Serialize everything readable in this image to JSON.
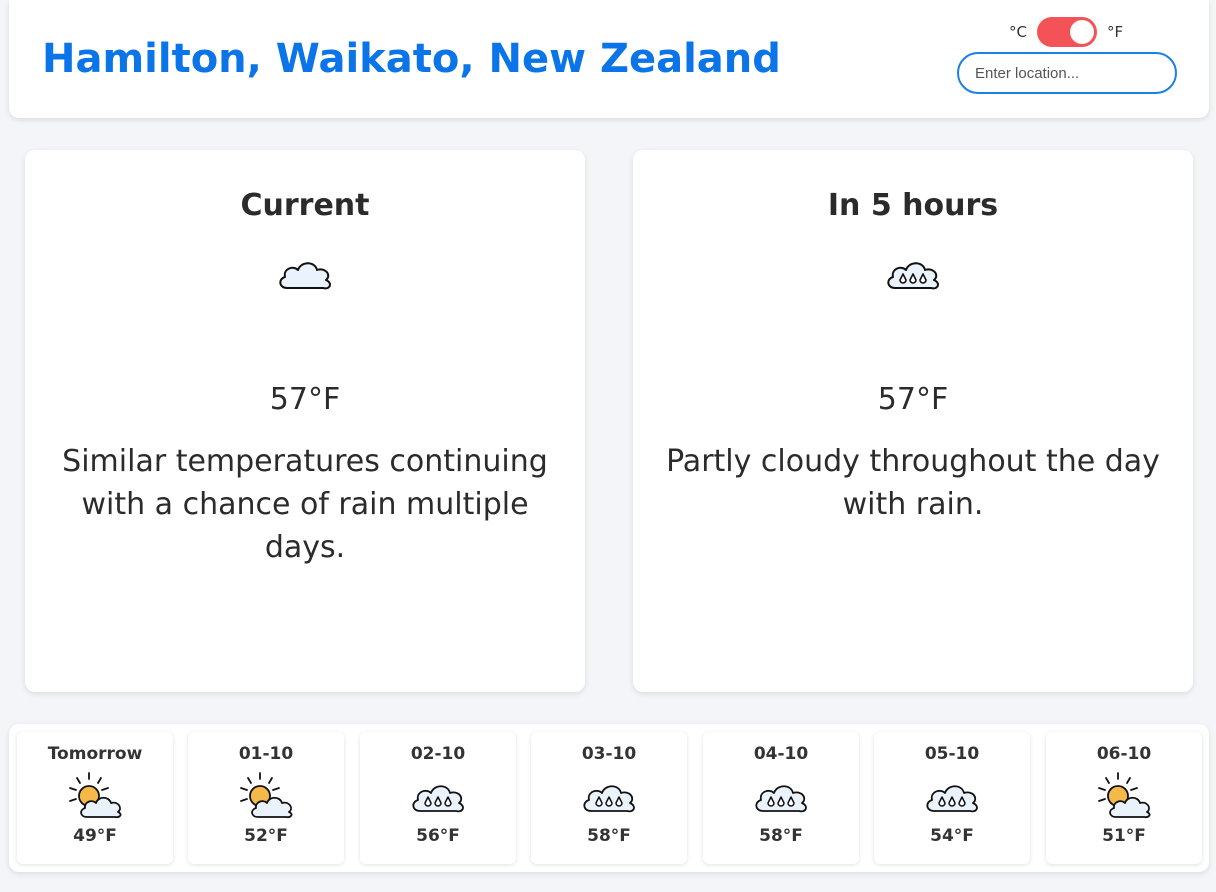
{
  "header": {
    "location": "Hamilton, Waikato, New Zealand",
    "unit_celsius": "°C",
    "unit_fahrenheit": "°F",
    "search_placeholder": "Enter location..."
  },
  "current": {
    "title": "Current",
    "icon": "cloud-icon",
    "temp": "57°F",
    "description": "Similar temperatures continuing with a chance of rain multiple days."
  },
  "later": {
    "title": "In 5 hours",
    "icon": "rain-cloud-icon",
    "temp": "57°F",
    "description": "Partly cloudy throughout the day with rain."
  },
  "forecast": [
    {
      "label": "Tomorrow",
      "icon": "partly-cloudy-icon",
      "temp": "49°F"
    },
    {
      "label": "01-10",
      "icon": "partly-cloudy-icon",
      "temp": "52°F"
    },
    {
      "label": "02-10",
      "icon": "rain-cloud-icon",
      "temp": "56°F"
    },
    {
      "label": "03-10",
      "icon": "rain-cloud-icon",
      "temp": "58°F"
    },
    {
      "label": "04-10",
      "icon": "rain-cloud-icon",
      "temp": "58°F"
    },
    {
      "label": "05-10",
      "icon": "rain-cloud-icon",
      "temp": "54°F"
    },
    {
      "label": "06-10",
      "icon": "partly-cloudy-icon",
      "temp": "51°F"
    }
  ],
  "colors": {
    "accent": "#0a74e8",
    "toggle": "#f35256",
    "sun": "#f5b94a",
    "cloud_fill": "#eaf2fb"
  }
}
